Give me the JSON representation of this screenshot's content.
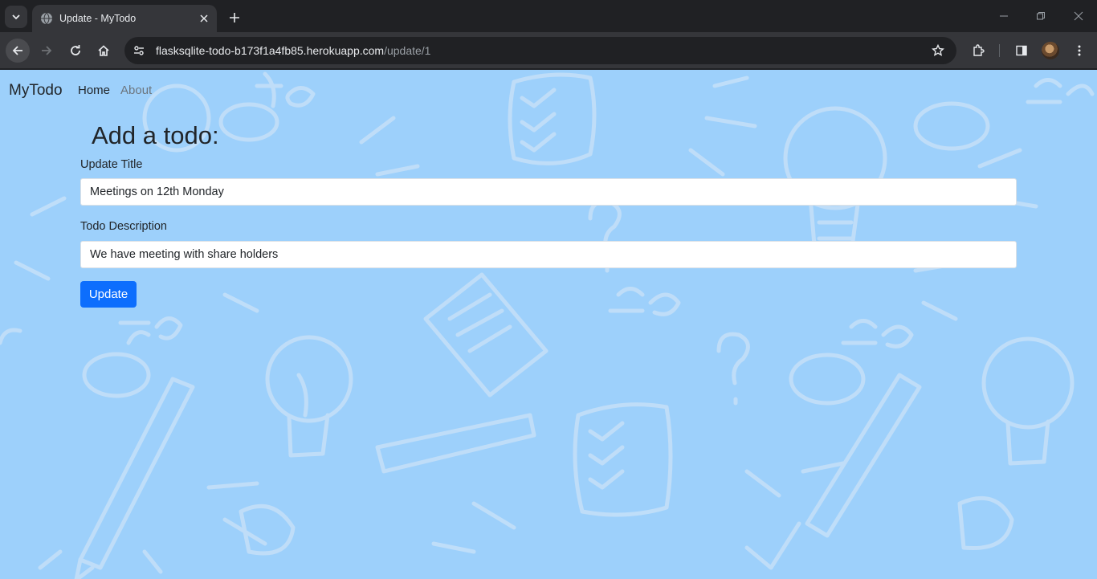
{
  "browser": {
    "tab_title": "Update - MyTodo",
    "url_host": "flasksqlite-todo-b173f1a4fb85.herokuapp.com",
    "url_path": "/update/1"
  },
  "nav": {
    "brand": "MyTodo",
    "links": [
      "Home",
      "About"
    ]
  },
  "form": {
    "heading": "Add a todo:",
    "title_label": "Update Title",
    "title_value": "Meetings on 12th Monday",
    "desc_label": "Todo Description",
    "desc_value": "We have meeting with share holders",
    "submit_label": "Update"
  },
  "colors": {
    "page_background": "#9dd0fb",
    "primary_button": "#0d6efd"
  }
}
